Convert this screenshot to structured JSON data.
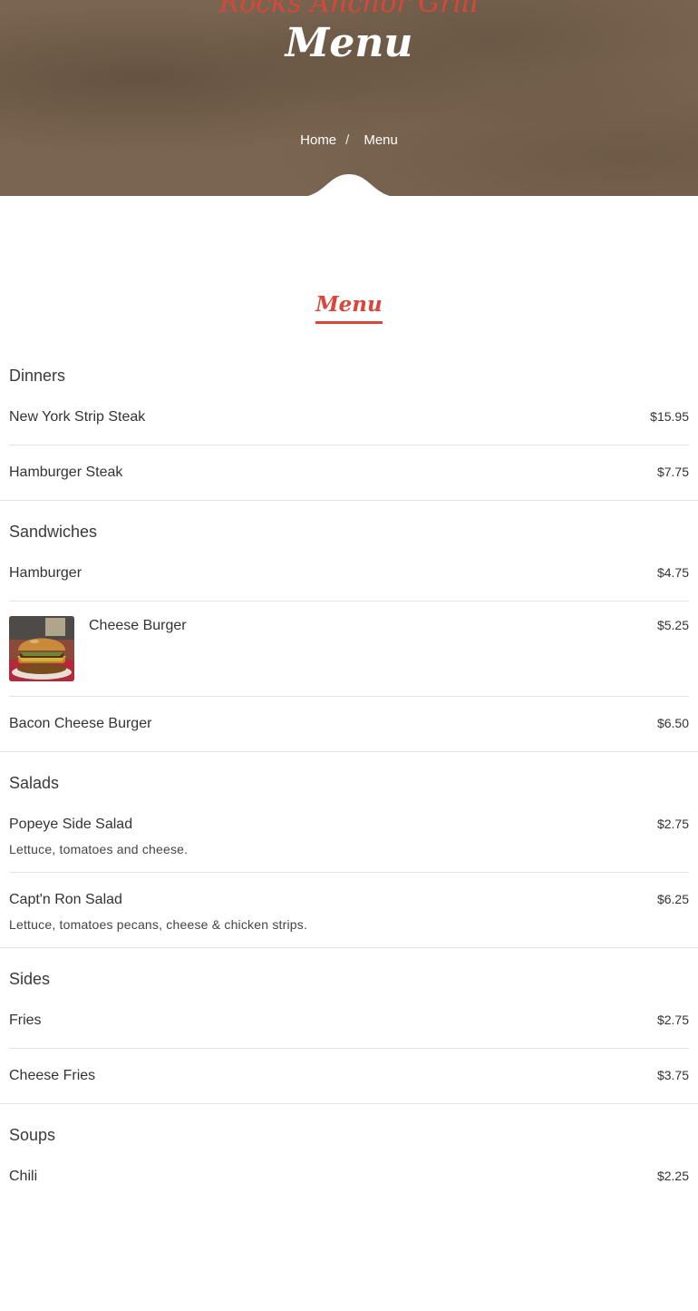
{
  "hero": {
    "brand": "Rocks Anchor Grill",
    "title": "Menu",
    "breadcrumb": {
      "home": "Home",
      "separator": "/",
      "current": "Menu"
    },
    "background_color": "#7a6550"
  },
  "section_title": "Menu",
  "accent_color": "#d9473b",
  "categories": [
    {
      "name": "Dinners",
      "items": [
        {
          "name": "New York Strip Steak",
          "price": "$15.95"
        },
        {
          "name": "Hamburger Steak",
          "price": "$7.75"
        }
      ]
    },
    {
      "name": "Sandwiches",
      "items": [
        {
          "name": "Hamburger",
          "price": "$4.75"
        },
        {
          "name": "Cheese Burger",
          "price": "$5.25",
          "image": "cheeseburger-photo"
        },
        {
          "name": "Bacon Cheese Burger",
          "price": "$6.50"
        }
      ]
    },
    {
      "name": "Salads",
      "items": [
        {
          "name": "Popeye Side Salad",
          "price": "$2.75",
          "description": "Lettuce, tomatoes and cheese."
        },
        {
          "name": "Capt'n Ron Salad",
          "price": "$6.25",
          "description": "Lettuce, tomatoes pecans, cheese & chicken strips."
        }
      ]
    },
    {
      "name": "Sides",
      "items": [
        {
          "name": "Fries",
          "price": "$2.75"
        },
        {
          "name": "Cheese Fries",
          "price": "$3.75"
        }
      ]
    },
    {
      "name": "Soups",
      "items": [
        {
          "name": "Chili",
          "price": "$2.25"
        }
      ]
    }
  ]
}
